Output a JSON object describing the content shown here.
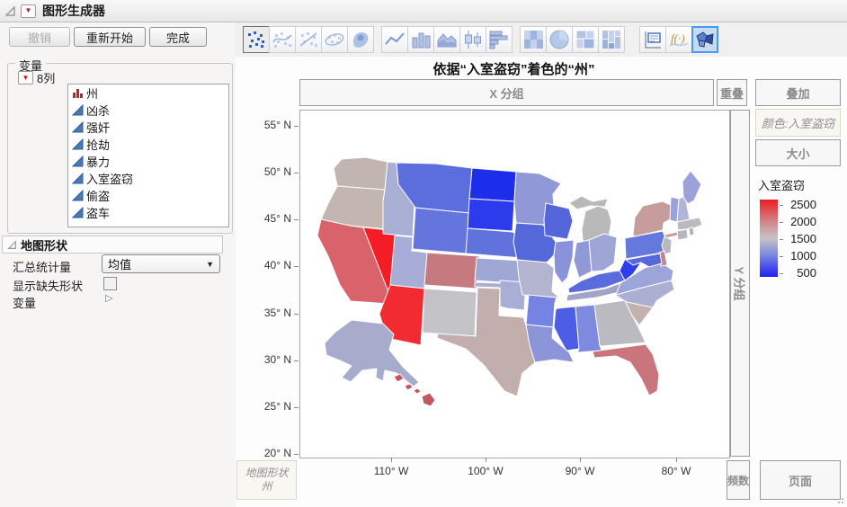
{
  "window": {
    "title": "图形生成器"
  },
  "action_bar": {
    "undo": "撤销",
    "restart": "重新开始",
    "done": "完成"
  },
  "toolbar": {
    "groups": [
      [
        "scatter-icon",
        "smoother-icon",
        "fit-line-icon",
        "ellipse-icon",
        "contour-icon"
      ],
      [
        "line-chart-icon",
        "bar-chart-icon",
        "area-chart-icon",
        "box-plot-icon",
        "histogram-icon"
      ],
      [
        "heatmap-icon",
        "pie-chart-icon",
        "treemap-icon",
        "mosaic-icon"
      ],
      [
        "caption-box-icon",
        "formula-icon",
        "map-shapes-icon"
      ]
    ],
    "pressed": "scatter-icon",
    "selected": "map-shapes-icon"
  },
  "variables_panel": {
    "title": "变量",
    "columns_label": "8列",
    "items": [
      {
        "label": "州",
        "type": "nominal"
      },
      {
        "label": "凶杀",
        "type": "continuous"
      },
      {
        "label": "强奸",
        "type": "continuous"
      },
      {
        "label": "抢劫",
        "type": "continuous"
      },
      {
        "label": "暴力",
        "type": "continuous"
      },
      {
        "label": "入室盗窃",
        "type": "continuous"
      },
      {
        "label": "偷盗",
        "type": "continuous"
      },
      {
        "label": "盗车",
        "type": "continuous"
      }
    ]
  },
  "map_shape_panel": {
    "title": "地图形状",
    "summary_label": "汇总统计量",
    "summary_value": "均值",
    "missing_label": "显示缺失形状",
    "missing_checked": false,
    "variables_label": "变量"
  },
  "graph": {
    "title": "依据“入室盗窃”着色的“州”",
    "zones": {
      "x_group": "X 分组",
      "overlap": "重叠",
      "overlay": "叠加",
      "color": "颜色:入室盗窃",
      "size": "大小",
      "y_group": "Y 分组",
      "freq": "频数",
      "page": "页面",
      "map_shape_line1": "地图形状",
      "map_shape_line2": "州"
    }
  },
  "legend": {
    "title": "入室盗窃",
    "ticks": [
      "2500",
      "2000",
      "1500",
      "1000",
      "500"
    ],
    "gradient": [
      "#ed1c24",
      "#d08a8e",
      "#c7c3c7",
      "#7b87e0",
      "#1f1ff2"
    ]
  },
  "chart_data": {
    "type": "choropleth-map",
    "shape_variable": "州",
    "color_variable": "入室盗窃",
    "summary_statistic": "均值",
    "color_scale": {
      "min": 500,
      "max": 2500,
      "low": "#1f1ff2",
      "mid": "#c7c3c7",
      "high": "#ed1c24"
    },
    "x_axis": {
      "label_ticks": [
        "110° W",
        "100° W",
        "90° W",
        "80° W"
      ]
    },
    "y_axis": {
      "label_ticks": [
        "55° N",
        "50° N",
        "45° N",
        "40° N",
        "35° N",
        "30° N",
        "25° N",
        "20° N"
      ]
    },
    "states": [
      {
        "id": "WA",
        "fill": "#c2b5b1"
      },
      {
        "id": "OR",
        "fill": "#c3b6b1"
      },
      {
        "id": "CA",
        "fill": "#d8636a"
      },
      {
        "id": "NV",
        "fill": "#f51d25"
      },
      {
        "id": "ID",
        "fill": "#a9aed4"
      },
      {
        "id": "MT",
        "fill": "#5c6ede"
      },
      {
        "id": "WY",
        "fill": "#6476de"
      },
      {
        "id": "UT",
        "fill": "#a7add6"
      },
      {
        "id": "CO",
        "fill": "#c67a80"
      },
      {
        "id": "AZ",
        "fill": "#f22b32"
      },
      {
        "id": "NM",
        "fill": "#c3c2c7"
      },
      {
        "id": "ND",
        "fill": "#1c2eea"
      },
      {
        "id": "SD",
        "fill": "#2c3cec"
      },
      {
        "id": "NE",
        "fill": "#6072dc"
      },
      {
        "id": "KS",
        "fill": "#9fa7d4"
      },
      {
        "id": "OK",
        "fill": "#a8aed4"
      },
      {
        "id": "TX",
        "fill": "#c2afad"
      },
      {
        "id": "MN",
        "fill": "#9098d8"
      },
      {
        "id": "IA",
        "fill": "#5568da"
      },
      {
        "id": "MO",
        "fill": "#b2b4d0"
      },
      {
        "id": "AR",
        "fill": "#7584e2"
      },
      {
        "id": "LA",
        "fill": "#8c94da"
      },
      {
        "id": "WI",
        "fill": "#5466da"
      },
      {
        "id": "IL",
        "fill": "#8a92dc"
      },
      {
        "id": "MI",
        "fill": "#b9b9b9"
      },
      {
        "id": "IN",
        "fill": "#9098d8"
      },
      {
        "id": "OH",
        "fill": "#9ea6d6"
      },
      {
        "id": "KY",
        "fill": "#5a6cdc"
      },
      {
        "id": "TN",
        "fill": "#9fa4c8"
      },
      {
        "id": "MS",
        "fill": "#4c5ee6"
      },
      {
        "id": "AL",
        "fill": "#7e8ade"
      },
      {
        "id": "GA",
        "fill": "#babac0"
      },
      {
        "id": "FL",
        "fill": "#ca747b"
      },
      {
        "id": "SC",
        "fill": "#c3b1ad"
      },
      {
        "id": "NC",
        "fill": "#abb0d2"
      },
      {
        "id": "VA",
        "fill": "#9ca4da"
      },
      {
        "id": "WV",
        "fill": "#2e3eea"
      },
      {
        "id": "PA",
        "fill": "#6678dc"
      },
      {
        "id": "NY",
        "fill": "#c69c9c"
      },
      {
        "id": "NJ",
        "fill": "#b9b9bd"
      },
      {
        "id": "DE",
        "fill": "#c8828a"
      },
      {
        "id": "MD",
        "fill": "#5668dc"
      },
      {
        "id": "VT",
        "fill": "#9ba2d8"
      },
      {
        "id": "NH",
        "fill": "#b0b5d8"
      },
      {
        "id": "ME",
        "fill": "#9ba2d8"
      },
      {
        "id": "MA",
        "fill": "#babac0"
      },
      {
        "id": "CT",
        "fill": "#b6b6c2"
      },
      {
        "id": "RI",
        "fill": "#bcb0b0"
      },
      {
        "id": "AK",
        "fill": "#a8accc"
      },
      {
        "id": "HI",
        "fill": "#c2575e"
      }
    ]
  }
}
